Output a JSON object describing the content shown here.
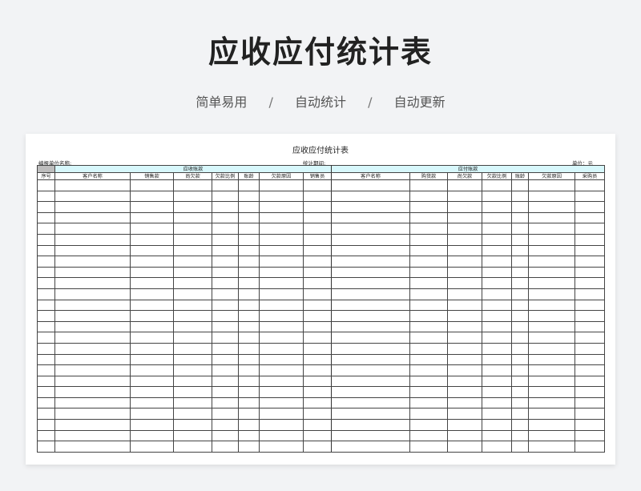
{
  "hero": {
    "title": "应收应付统计表",
    "tags": [
      "简单易用",
      "自动统计",
      "自动更新"
    ],
    "separator": "/"
  },
  "sheet": {
    "title": "应收应付统计表",
    "org_label": "编报单位名称:",
    "period_label": "统计期间:",
    "unit_label": "单位：元",
    "receivable": {
      "group_label": "应收账款",
      "columns": [
        "序号",
        "客户名称",
        "销售款",
        "尚欠款",
        "欠款比例",
        "账龄",
        "欠款原因",
        "销售员"
      ]
    },
    "payable": {
      "group_label": "应付账款",
      "columns": [
        "客户名称",
        "购货款",
        "尚欠款",
        "欠款比例",
        "账龄",
        "欠款原因",
        "采购员"
      ]
    },
    "empty_rows": 25
  }
}
